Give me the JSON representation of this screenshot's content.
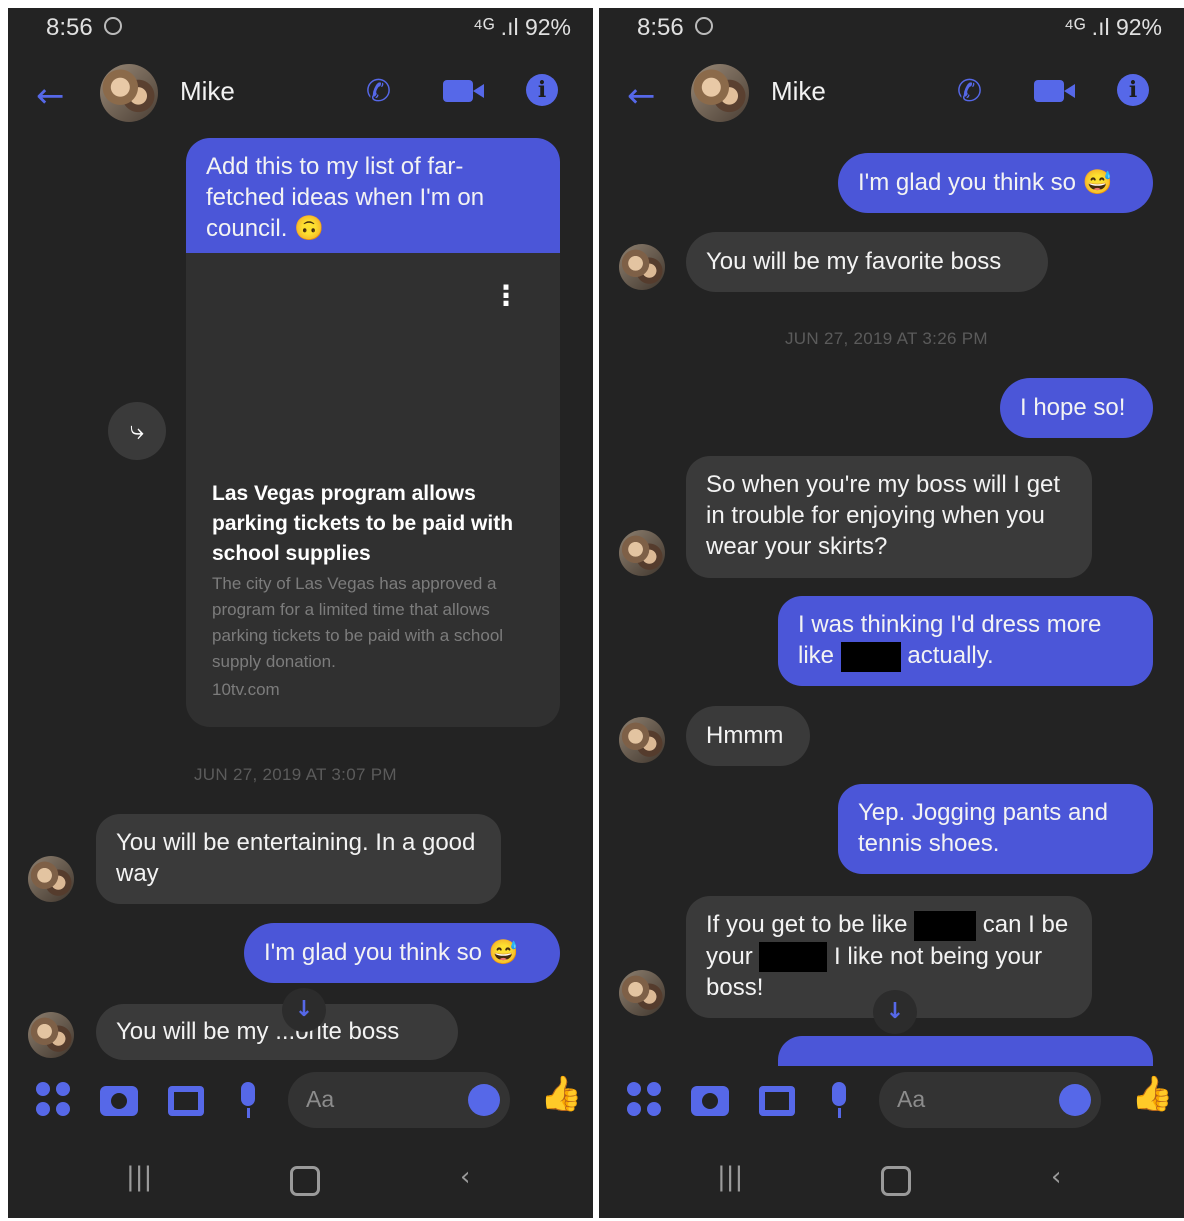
{
  "left_screen": {
    "status": {
      "time": "8:56",
      "right": "⁴ᴳ .ıl 92%"
    },
    "header": {
      "contact_name": "Mike"
    },
    "messages": {
      "m1": "Add this to my list of far-fetched ideas when I'm on council. 🙃",
      "link_title": "Las Vegas program allows parking tickets to be paid with school supplies",
      "link_description": "The city of Las Vegas has approved a program for a limited time that allows parking tickets to be paid with a school supply donation.",
      "link_domain": "10tv.com",
      "timestamp": "JUN 27, 2019 AT 3:07 PM",
      "m2": "You will be entertaining.  In a good way",
      "m3": "I'm glad you think so 😅",
      "m4_a": "You will be my ",
      "m4_b": "...",
      "m4_c": "orite boss"
    },
    "composer": {
      "placeholder": "Aa"
    }
  },
  "right_screen": {
    "status": {
      "time": "8:56",
      "right": "⁴ᴳ .ıl 92%"
    },
    "header": {
      "contact_name": "Mike"
    },
    "messages": {
      "m1": "I'm glad you think so 😅",
      "m2": "You will be my favorite boss",
      "timestamp": "JUN 27, 2019 AT 3:26 PM",
      "m3": "I hope so!",
      "m4": "So when you're my boss will I get in trouble for enjoying when you wear your skirts?",
      "m5_a": "I was thinking I'd dress more like ",
      "m5_b": " actually.",
      "m6": "Hmmm",
      "m7": "Yep. Jogging pants and tennis shoes.",
      "m8_a": "If you get to be like ",
      "m8_b": " can I be your ",
      "m8_c": " I like not being your boss!"
    },
    "composer": {
      "placeholder": "Aa"
    }
  },
  "icons": [
    "back-arrow-icon",
    "phone-icon",
    "video-icon",
    "info-icon",
    "share-icon",
    "kebab-icon",
    "apps-icon",
    "camera-icon",
    "gallery-icon",
    "mic-icon",
    "emoji-icon",
    "thumbs-up-icon",
    "scroll-down-icon",
    "recents-icon",
    "home-icon",
    "nav-back-icon"
  ],
  "colors": {
    "outgoing_bubble": "#4b56d8",
    "incoming_bubble": "#3a3a3a",
    "accent": "#5668e8",
    "background": "#232323"
  }
}
